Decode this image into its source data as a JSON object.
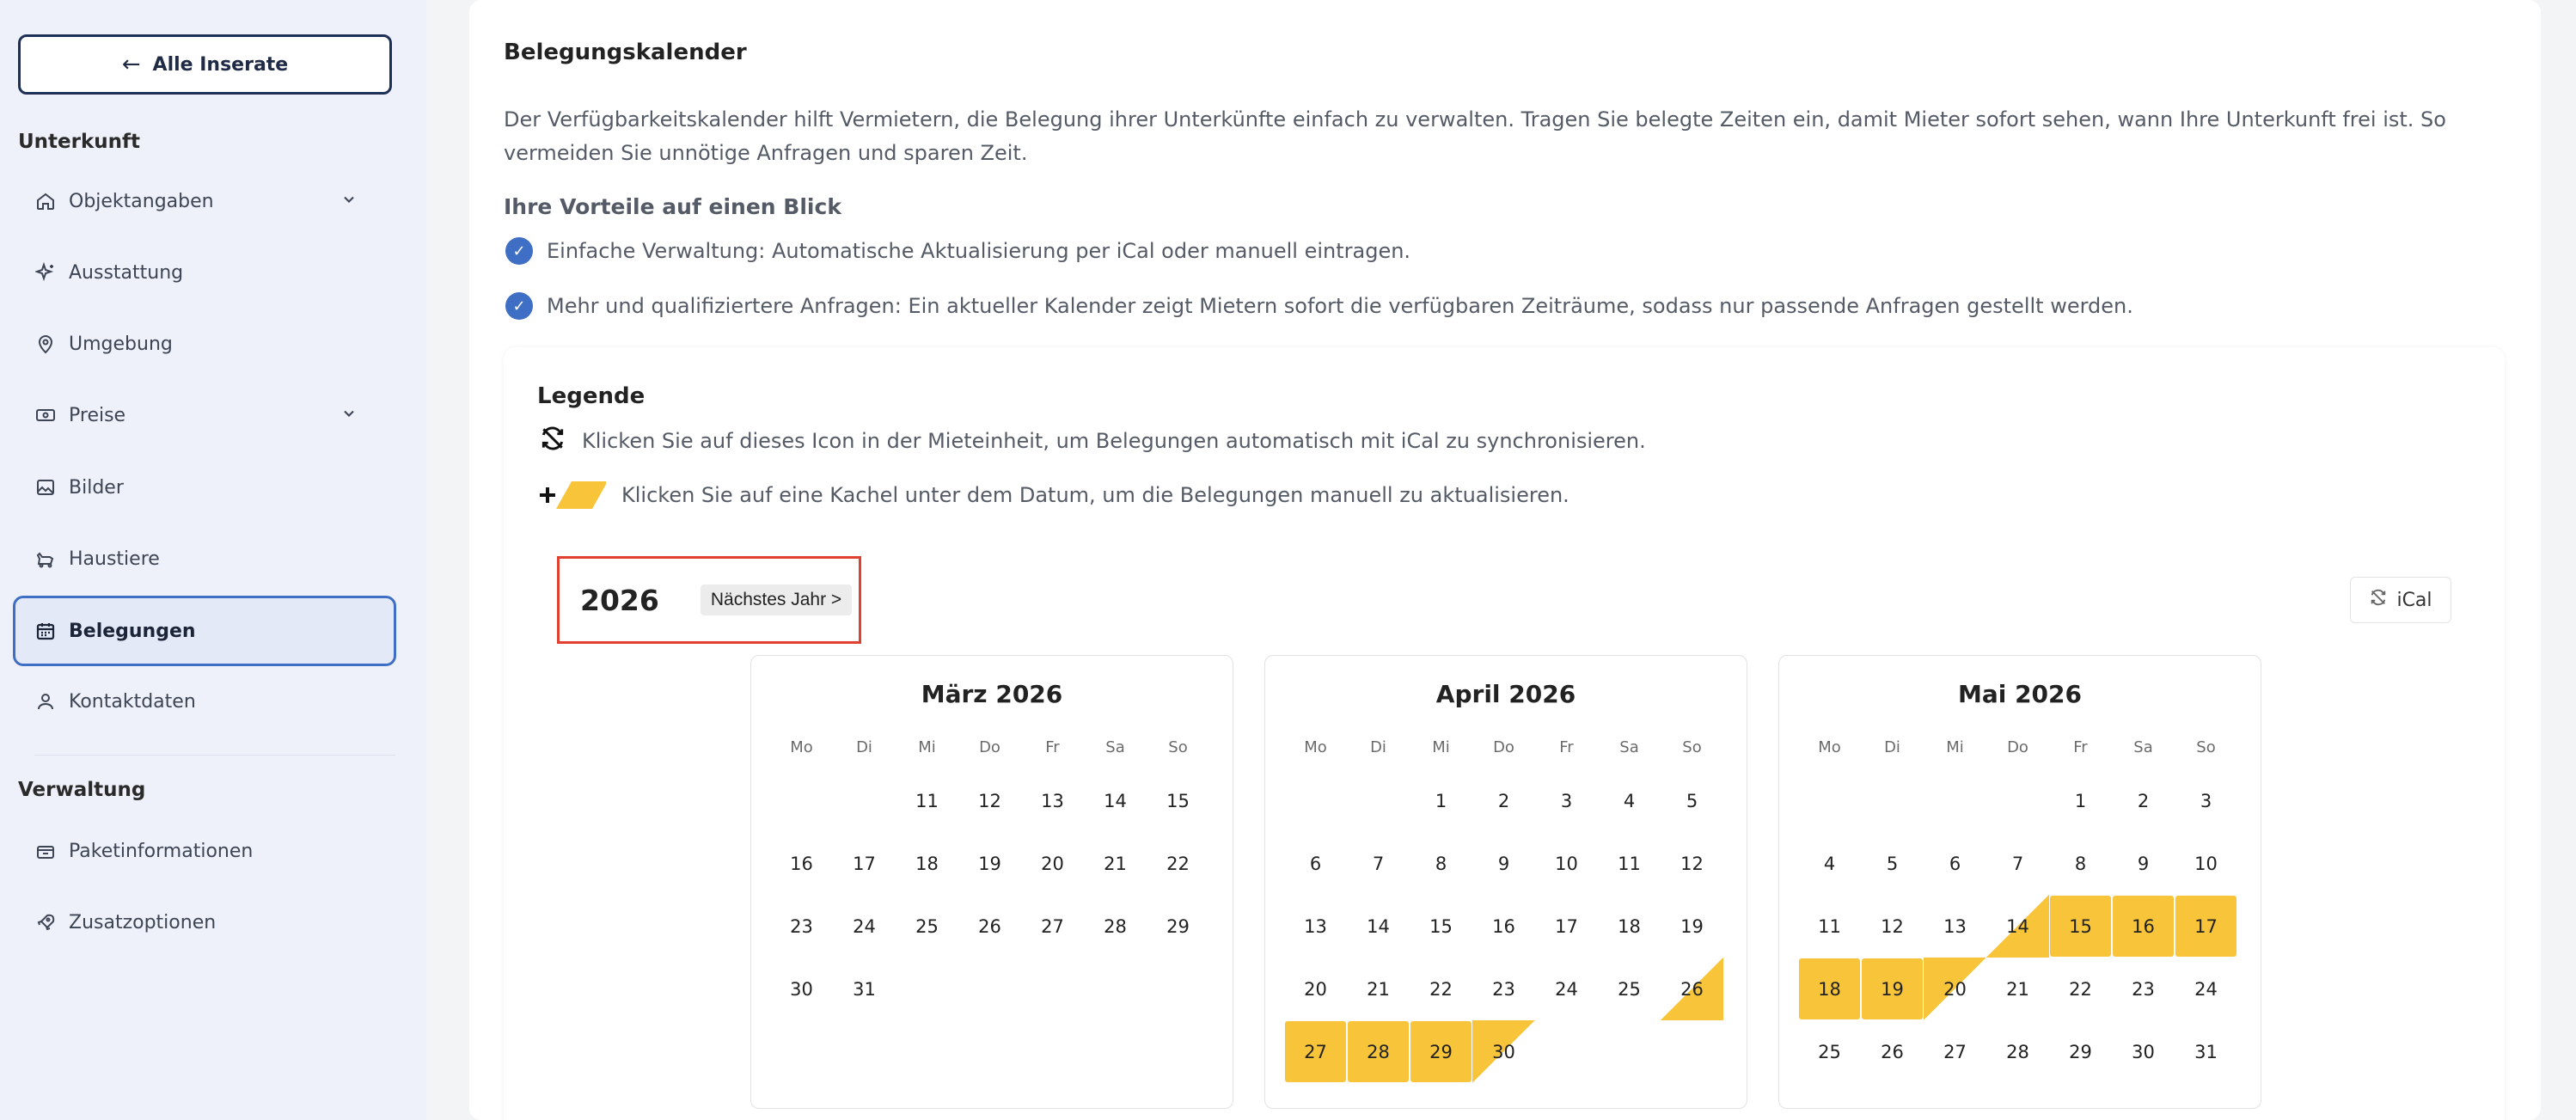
{
  "sidebar": {
    "back_label": "Alle Inserate",
    "section_unterkunft": "Unterkunft",
    "items": [
      {
        "label": "Objektangaben",
        "icon": "home-icon",
        "expandable": true
      },
      {
        "label": "Ausstattung",
        "icon": "sparkles-icon",
        "expandable": false
      },
      {
        "label": "Umgebung",
        "icon": "map-pin-icon",
        "expandable": false
      },
      {
        "label": "Preise",
        "icon": "banknote-icon",
        "expandable": true
      },
      {
        "label": "Bilder",
        "icon": "image-icon",
        "expandable": false
      },
      {
        "label": "Haustiere",
        "icon": "pet-icon",
        "expandable": false
      },
      {
        "label": "Belegungen",
        "icon": "calendar-icon",
        "expandable": false,
        "active": true
      },
      {
        "label": "Kontaktdaten",
        "icon": "user-icon",
        "expandable": false
      }
    ],
    "section_verwaltung": "Verwaltung",
    "admin_items": [
      {
        "label": "Paketinformationen",
        "icon": "package-icon"
      },
      {
        "label": "Zusatzoptionen",
        "icon": "rocket-icon"
      }
    ]
  },
  "main": {
    "title": "Belegungskalender",
    "intro": "Der Verfügbarkeitskalender hilft Vermietern, die Belegung ihrer Unterkünfte einfach zu verwalten. Tragen Sie belegte Zeiten ein, damit Mieter sofort sehen, wann Ihre Unterkunft frei ist. So vermeiden Sie unnötige Anfragen und sparen Zeit.",
    "benefits_title": "Ihre Vorteile auf einen Blick",
    "benefits": [
      "Einfache Verwaltung: Automatische Aktualisierung per iCal oder manuell eintragen.",
      "Mehr und qualifiziertere Anfragen: Ein aktueller Kalender zeigt Mietern sofort die verfügbaren Zeiträume, sodass nur passende Anfragen gestellt werden."
    ],
    "legend": {
      "title": "Legende",
      "sync_text": "Klicken Sie auf dieses Icon in der Mieteinheit, um Belegungen automatisch mit iCal zu synchronisieren.",
      "manual_text": "Klicken Sie auf eine Kachel unter dem Datum, um die Belegungen manuell zu aktualisieren."
    },
    "year": "2026",
    "next_year_label": "Nächstes Jahr >",
    "ical_label": "iCal"
  },
  "colors": {
    "accent_blue": "#3f6fc4",
    "booked_yellow": "#f7c43a",
    "highlight_red": "#e0402f"
  },
  "calendar": {
    "weekdays": [
      "Mo",
      "Di",
      "Mi",
      "Do",
      "Fr",
      "Sa",
      "So"
    ],
    "months": [
      {
        "title": "März 2026",
        "offset": 2,
        "days": [
          11,
          12,
          13,
          14,
          15,
          16,
          17,
          18,
          19,
          20,
          21,
          22,
          23,
          24,
          25,
          26,
          27,
          28,
          29,
          30,
          31
        ],
        "booked": [],
        "arrive": [],
        "depart": []
      },
      {
        "title": "April 2026",
        "offset": 2,
        "days": [
          1,
          2,
          3,
          4,
          5,
          6,
          7,
          8,
          9,
          10,
          11,
          12,
          13,
          14,
          15,
          16,
          17,
          18,
          19,
          20,
          21,
          22,
          23,
          24,
          25,
          26,
          27,
          28,
          29,
          30
        ],
        "booked": [
          27,
          28,
          29
        ],
        "arrive": [
          26
        ],
        "depart": [
          30
        ]
      },
      {
        "title": "Mai 2026",
        "offset": 4,
        "days": [
          1,
          2,
          3,
          4,
          5,
          6,
          7,
          8,
          9,
          10,
          11,
          12,
          13,
          14,
          15,
          16,
          17,
          18,
          19,
          20,
          21,
          22,
          23,
          24,
          25,
          26,
          27,
          28,
          29,
          30,
          31
        ],
        "booked": [
          15,
          16,
          17,
          18,
          19
        ],
        "arrive": [
          14
        ],
        "depart": [
          20
        ]
      }
    ]
  }
}
